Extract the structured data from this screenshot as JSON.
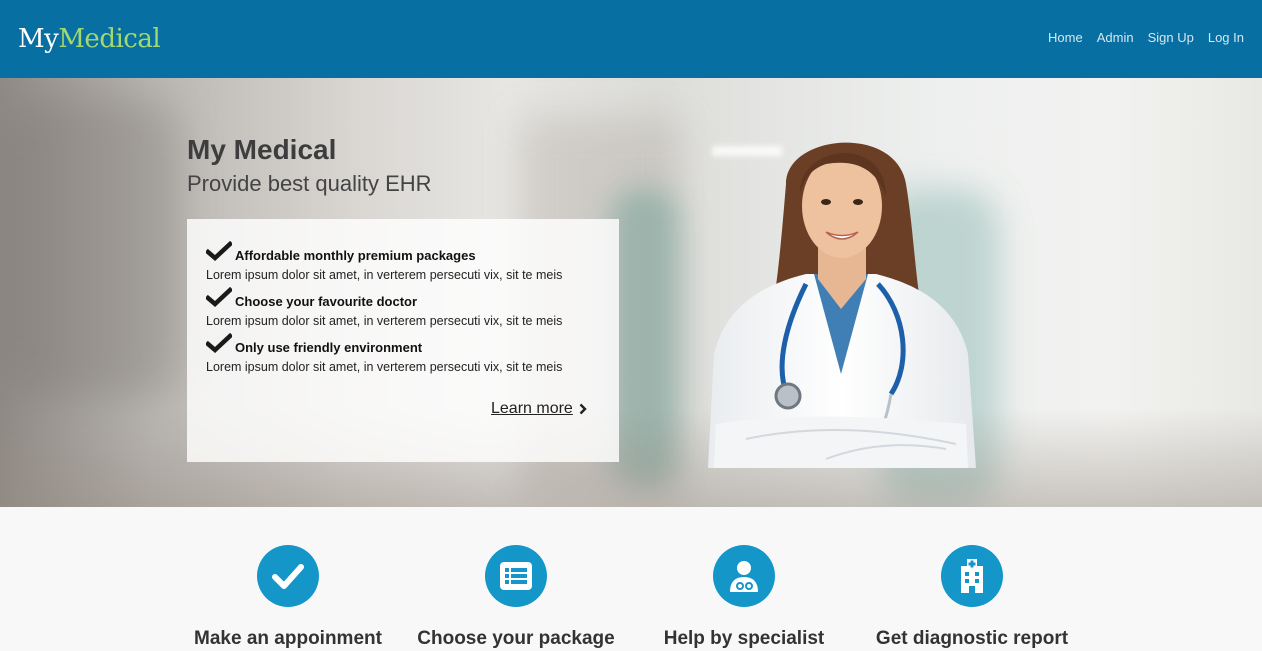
{
  "brand": {
    "part1": "My",
    "part2": "Medical"
  },
  "nav": {
    "items": [
      "Home",
      "Admin",
      "Sign Up",
      "Log In"
    ]
  },
  "hero": {
    "title": "My Medical",
    "subtitle": "Provide best quality EHR",
    "features": [
      {
        "title": "Affordable monthly premium packages",
        "desc": "Lorem ipsum dolor sit amet, in verterem persecuti vix, sit te meis"
      },
      {
        "title": "Choose your favourite doctor",
        "desc": "Lorem ipsum dolor sit amet, in verterem persecuti vix, sit te meis"
      },
      {
        "title": "Only use friendly environment",
        "desc": "Lorem ipsum dolor sit amet, in verterem persecuti vix, sit te meis"
      }
    ],
    "learn_more": "Learn more"
  },
  "services": [
    {
      "title": "Make an appoinment",
      "icon": "check-icon"
    },
    {
      "title": "Choose your package",
      "icon": "list-icon"
    },
    {
      "title": "Help by specialist",
      "icon": "doctor-icon"
    },
    {
      "title": "Get diagnostic report",
      "icon": "hospital-icon"
    }
  ],
  "colors": {
    "navbar": "#076fa1",
    "brand_accent": "#a4d86e",
    "service_icon_bg": "#1496c9"
  }
}
